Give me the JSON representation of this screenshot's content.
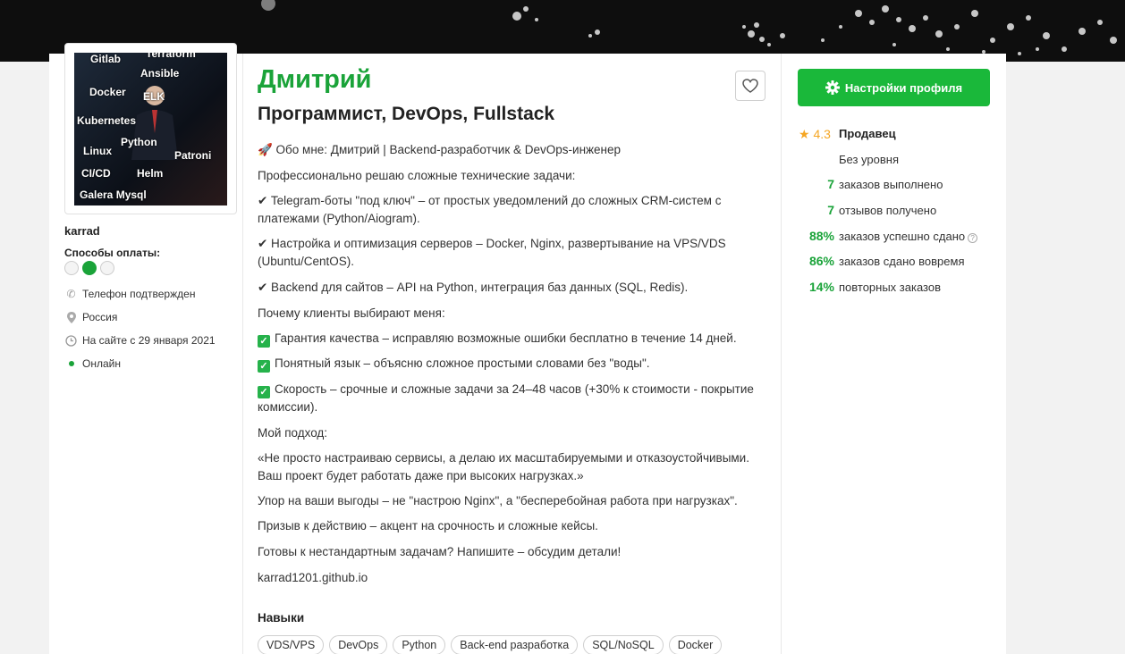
{
  "profile": {
    "name": "Дмитрий",
    "title": "Программист, DevOps, Fullstack",
    "username": "karrad"
  },
  "avatar_tags": [
    "Gitlab",
    "Terraform",
    "Ansible",
    "Docker",
    "ELK",
    "Kubernetes",
    "Python",
    "Linux",
    "Patroni",
    "CI/CD",
    "Helm",
    "Galera Mysql"
  ],
  "payment": {
    "title": "Способы оплаты:"
  },
  "info": {
    "phone": "Телефон подтвержден",
    "country": "Россия",
    "since": "На сайте с 29 января 2021",
    "status": "Онлайн"
  },
  "about": {
    "intro": "🚀 Обо мне: Дмитрий | Backend-разработчик & DevOps-инженер",
    "p1": "Профессионально решаю сложные технические задачи:",
    "b1": "✔ Telegram-боты \"под ключ\" – от простых уведомлений до сложных CRM-систем с платежами (Python/Aiogram).",
    "b2": "✔ Настройка и оптимизация серверов – Docker, Nginx, развертывание на VPS/VDS (Ubuntu/CentOS).",
    "b3": "✔ Backend для сайтов – API на Python, интеграция баз данных (SQL, Redis).",
    "p2": "Почему клиенты выбирают меня:",
    "c1": "Гарантия качества – исправляю возможные ошибки бесплатно в течение 14 дней.",
    "c2": "Понятный язык – объясню сложное простыми словами без \"воды\".",
    "c3": "Скорость – срочные и сложные задачи за 24–48 часов (+30% к стоимости - покрытие комиссии).",
    "p3": "Мой подход:",
    "p4": "«Не просто настраиваю сервисы, а делаю их масштабируемыми и отказоустойчивыми. Ваш проект будет работать даже при высоких нагрузках.»",
    "p5": "Упор на ваши выгоды – не \"настрою Nginx\", а \"бесперебойная работа при нагрузках\".",
    "p6": "Призыв к действию – акцент на срочность и сложные кейсы.",
    "p7": "Готовы к нестандартным задачам? Напишите – обсудим детали!",
    "link": "karrad1201.github.io"
  },
  "skills": {
    "title": "Навыки",
    "items": [
      "VDS/VPS",
      "DevOps",
      "Python",
      "Back-end разработка",
      "SQL/NoSQL",
      "Docker"
    ]
  },
  "sidebar": {
    "settings_label": "Настройки профиля",
    "rating": "4.3",
    "role": "Продавец",
    "level": "Без уровня",
    "stats": [
      {
        "value": "7",
        "label": "заказов выполнено"
      },
      {
        "value": "7",
        "label": "отзывов получено"
      },
      {
        "value": "88%",
        "label": "заказов успешно сдано"
      },
      {
        "value": "86%",
        "label": "заказов сдано вовремя"
      },
      {
        "value": "14%",
        "label": "повторных заказов"
      }
    ]
  },
  "colors": {
    "accent": "#1aa339",
    "button": "#1ab83a",
    "star": "#f5a623"
  }
}
